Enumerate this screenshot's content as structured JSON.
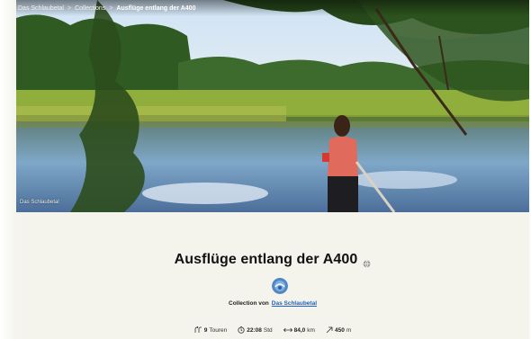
{
  "breadcrumb": {
    "items": [
      {
        "label": "Das Schlaubetal"
      },
      {
        "label": "Collections"
      },
      {
        "label": "Ausflüge entlang der A400"
      }
    ],
    "separator": ">"
  },
  "hero": {
    "credit": "Das Schlaubetal"
  },
  "collection": {
    "title": "Ausflüge entlang der A400",
    "visibility_icon": "globe-icon",
    "author_prefix": "Collection von",
    "author_name": "Das Schlaubetal"
  },
  "stats": {
    "tours_value": "9",
    "tours_unit": "Touren",
    "duration_value": "22:08",
    "duration_unit": "Std",
    "distance_value": "84,0",
    "distance_unit": "km",
    "ascent_value": "450",
    "ascent_unit": "m"
  },
  "colors": {
    "link": "#1d5fbf",
    "background": "#f4f4ec"
  }
}
